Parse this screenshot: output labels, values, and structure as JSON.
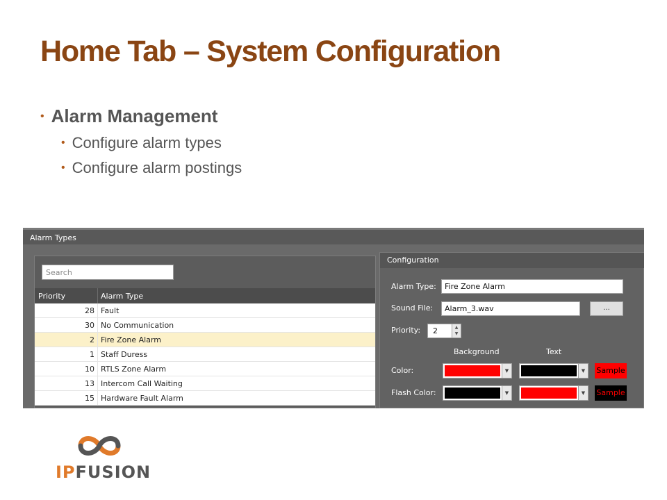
{
  "slide": {
    "title": "Home Tab – System Configuration",
    "bullet_main": "Alarm Management",
    "bullet_sub": [
      "Configure alarm types",
      "Configure alarm postings"
    ]
  },
  "window": {
    "title": "Alarm Types",
    "search_placeholder": "Search",
    "columns": [
      "Priority",
      "Alarm Type"
    ],
    "rows": [
      {
        "priority": "28",
        "name": "Fault"
      },
      {
        "priority": "30",
        "name": "No Communication"
      },
      {
        "priority": "2",
        "name": "Fire Zone Alarm",
        "selected": true
      },
      {
        "priority": "1",
        "name": "Staff Duress"
      },
      {
        "priority": "10",
        "name": "RTLS Zone Alarm"
      },
      {
        "priority": "13",
        "name": "Intercom Call Waiting"
      },
      {
        "priority": "15",
        "name": "Hardware Fault Alarm"
      }
    ]
  },
  "config": {
    "title": "Configuration",
    "alarm_type_label": "Alarm Type:",
    "alarm_type_value": "Fire Zone Alarm",
    "sound_file_label": "Sound File:",
    "sound_file_value": "Alarm_3.wav",
    "browse_label": "...",
    "priority_label": "Priority:",
    "priority_value": "2",
    "background_header": "Background",
    "text_header": "Text",
    "color_label": "Color:",
    "flash_color_label": "Flash Color:",
    "sample_label": "Sample",
    "color_background": "#ff0000",
    "color_text": "#000000",
    "flash_background": "#000000",
    "flash_text": "#ff0000"
  },
  "logo": {
    "text_ip": "IP",
    "text_fusion": "FUSION"
  },
  "colors": {
    "title": "#8a4513",
    "accent": "#b05a1a",
    "logo_ip": "#e07a2a",
    "logo_fusion": "#555555"
  }
}
